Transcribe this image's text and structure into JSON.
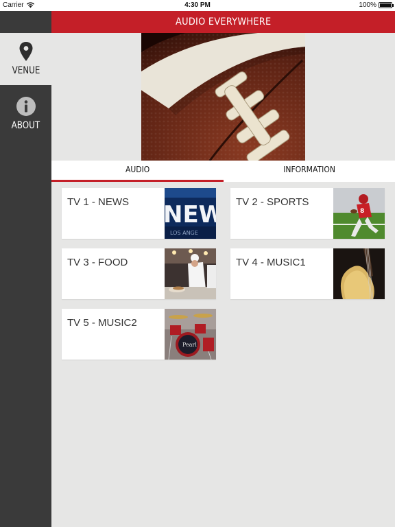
{
  "status_bar": {
    "carrier": "Carrier",
    "time": "4:30 PM",
    "battery": "100%",
    "battery_level": 1.0
  },
  "header": {
    "title": "AUDIO EVERYWHERE"
  },
  "sidebar": {
    "items": [
      {
        "label": "VENUE",
        "icon": "map-pin-icon",
        "active": true
      },
      {
        "label": "ABOUT",
        "icon": "info-icon",
        "active": false
      }
    ]
  },
  "hero": {
    "image": "football-closeup-image"
  },
  "tabs": [
    {
      "label": "AUDIO",
      "active": true
    },
    {
      "label": "INFORMATION",
      "active": false
    }
  ],
  "channels": [
    {
      "label": "TV 1 - NEWS",
      "thumb": "news-thumbnail"
    },
    {
      "label": "TV 2 - SPORTS",
      "thumb": "sports-thumbnail"
    },
    {
      "label": "TV 3 - FOOD",
      "thumb": "food-thumbnail"
    },
    {
      "label": "TV 4 - MUSIC1",
      "thumb": "guitar-thumbnail"
    },
    {
      "label": "TV 5 - MUSIC2",
      "thumb": "drums-thumbnail"
    }
  ],
  "colors": {
    "brand_red": "#c41f28",
    "sidebar_bg": "#3a3a3a",
    "content_bg": "#e6e6e5"
  }
}
